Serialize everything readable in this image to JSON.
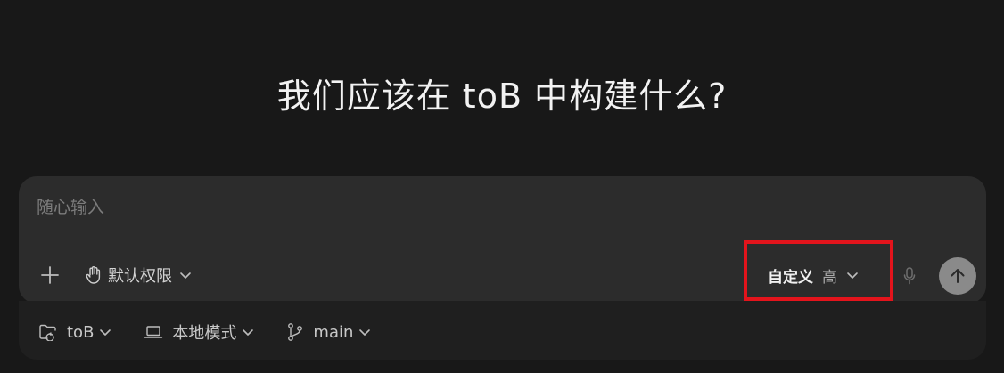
{
  "headline": "我们应该在 toB 中构建什么?",
  "composer": {
    "input_placeholder": "随心输入",
    "input_value": "",
    "permission_label": "默认权限",
    "model_name": "自定义",
    "model_level": "高"
  },
  "footer": {
    "project_label": "toB",
    "mode_label": "本地模式",
    "branch_label": "main"
  },
  "colors": {
    "background": "#181818",
    "composer_bg": "#2c2c2c",
    "footer_bg": "#1f1f1f",
    "send_button": "#8a8a8a",
    "highlight": "#e3141c"
  },
  "icons": {
    "add": "plus-icon",
    "permission": "hand-icon",
    "mic": "microphone-icon",
    "send": "arrow-up-icon",
    "project": "folder-icon",
    "mode": "laptop-icon",
    "branch": "git-branch-icon",
    "dropdown": "chevron-down-icon"
  }
}
